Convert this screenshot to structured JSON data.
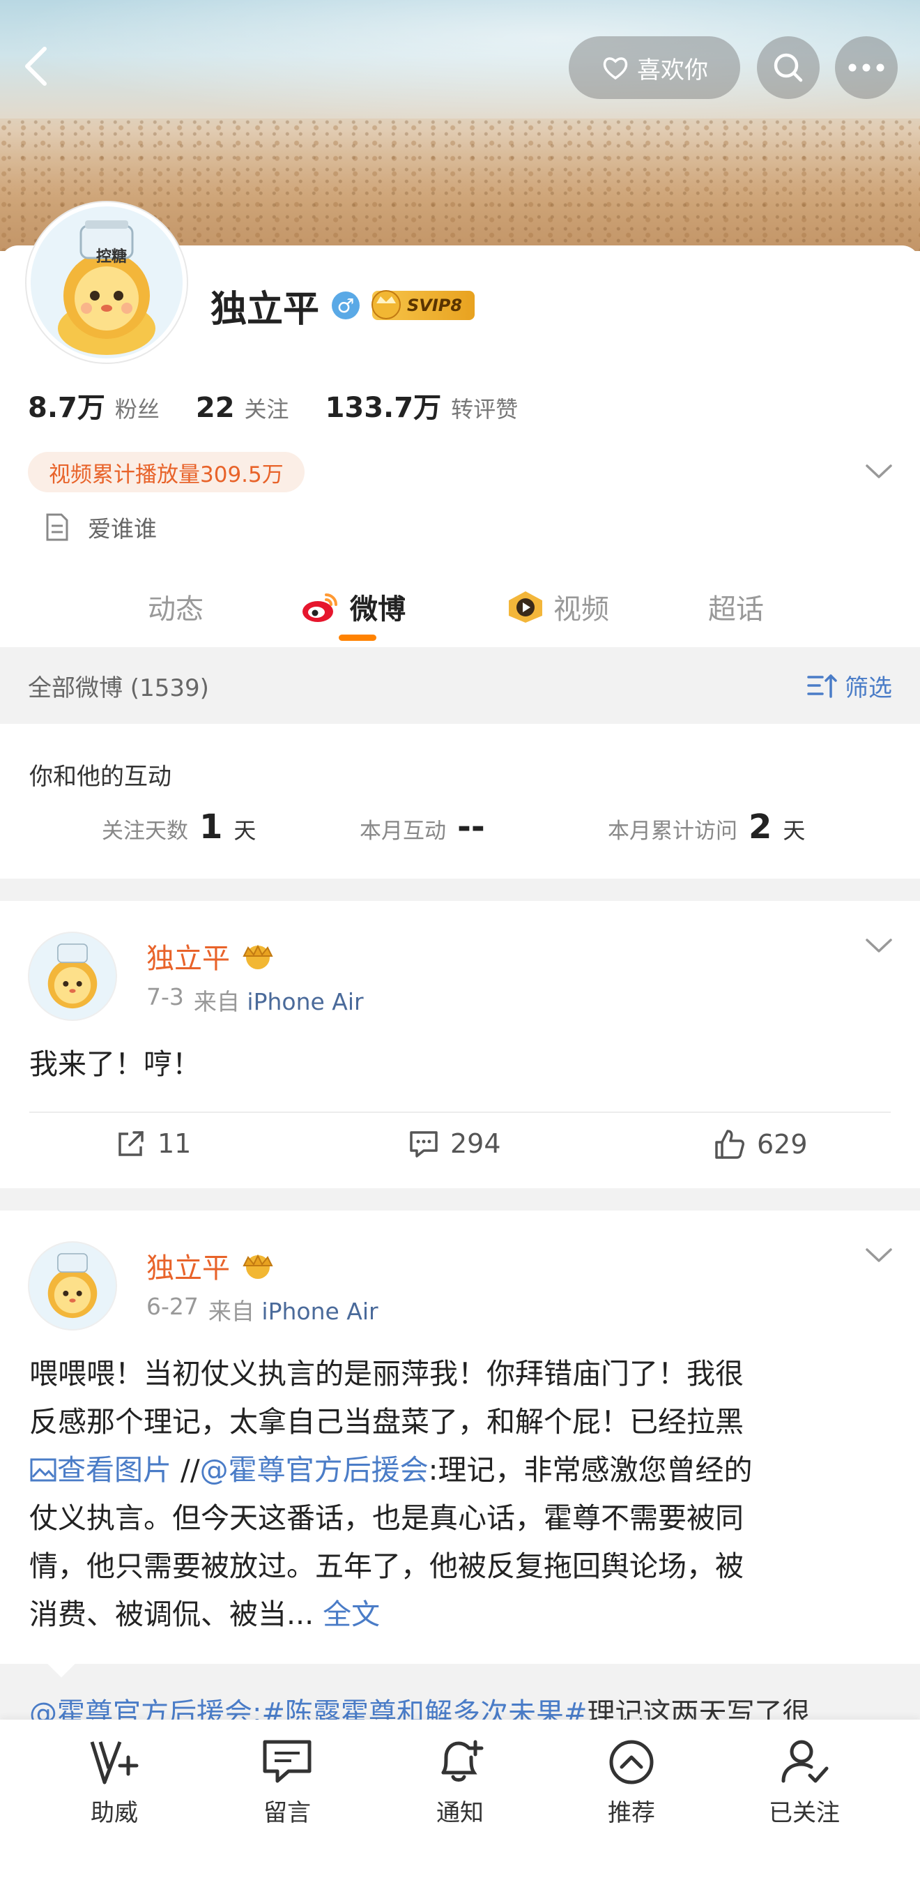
{
  "header": {
    "like_label": "喜欢你"
  },
  "profile": {
    "name": "独立平",
    "gender_symbol": "♂",
    "vip_label": "SVIP8",
    "avatar_jar_label": "控糖",
    "stats": [
      {
        "value": "8.7万",
        "label": "粉丝"
      },
      {
        "value": "22",
        "label": "关注"
      },
      {
        "value": "133.7万",
        "label": "转评赞"
      }
    ],
    "video_badge": "视频累计播放量309.5万",
    "bio": "爱谁谁"
  },
  "tabs": [
    {
      "label": "动态"
    },
    {
      "label": "微博"
    },
    {
      "label": "视频"
    },
    {
      "label": "超话"
    }
  ],
  "filter": {
    "all_label": "全部微博 (1539)",
    "filter_label": "筛选"
  },
  "interaction": {
    "title": "你和他的互动",
    "metrics": [
      {
        "key": "关注天数",
        "value": "1",
        "unit": "天"
      },
      {
        "key": "本月互动",
        "value": "--",
        "unit": ""
      },
      {
        "key": "本月累计访问",
        "value": "2",
        "unit": "天"
      }
    ]
  },
  "posts": [
    {
      "author": "独立平",
      "date": "7-3",
      "from": "来自",
      "source": "iPhone Air",
      "text": "我来了！哼！",
      "reposts": "11",
      "comments": "294",
      "likes": "629"
    },
    {
      "author": "独立平",
      "date": "6-27",
      "from": "来自",
      "source": "iPhone Air",
      "text_line1": "喂喂喂！当初仗义执言的是丽萍我！你拜错庙门了！我很",
      "text_line2": "反感那个理记，太拿自己当盘菜了，和解个屁！已经拉黑",
      "view_image": "查看图片",
      "repost_sep": " //",
      "mention": "@霍尊官方后援会",
      "text_line3_rest": ":理记，非常感激您曾经的",
      "text_line4": "仗义执言。但今天这番话，也是真心话，霍尊不需要被同",
      "text_line5": "情，他只需要被放过。五年了，他被反复拖回舆论场，被",
      "text_line6": "消费、被调侃、被当...",
      "full_text": "全文",
      "repost_mention": "@霍尊官方后援会",
      "repost_hashtag": ":#陈露霍尊和解多次未果#",
      "repost_rest": "理记这两天写了很"
    }
  ],
  "bottom_bar": [
    {
      "label": "助威",
      "icon": "cheer-icon"
    },
    {
      "label": "留言",
      "icon": "message-icon"
    },
    {
      "label": "通知",
      "icon": "bell-icon"
    },
    {
      "label": "推荐",
      "icon": "recommend-icon"
    },
    {
      "label": "已关注",
      "icon": "followed-icon"
    }
  ],
  "colors": {
    "accent_orange": "#ff8200",
    "name_orange": "#e8632a",
    "link_blue": "#4a7cc7"
  }
}
